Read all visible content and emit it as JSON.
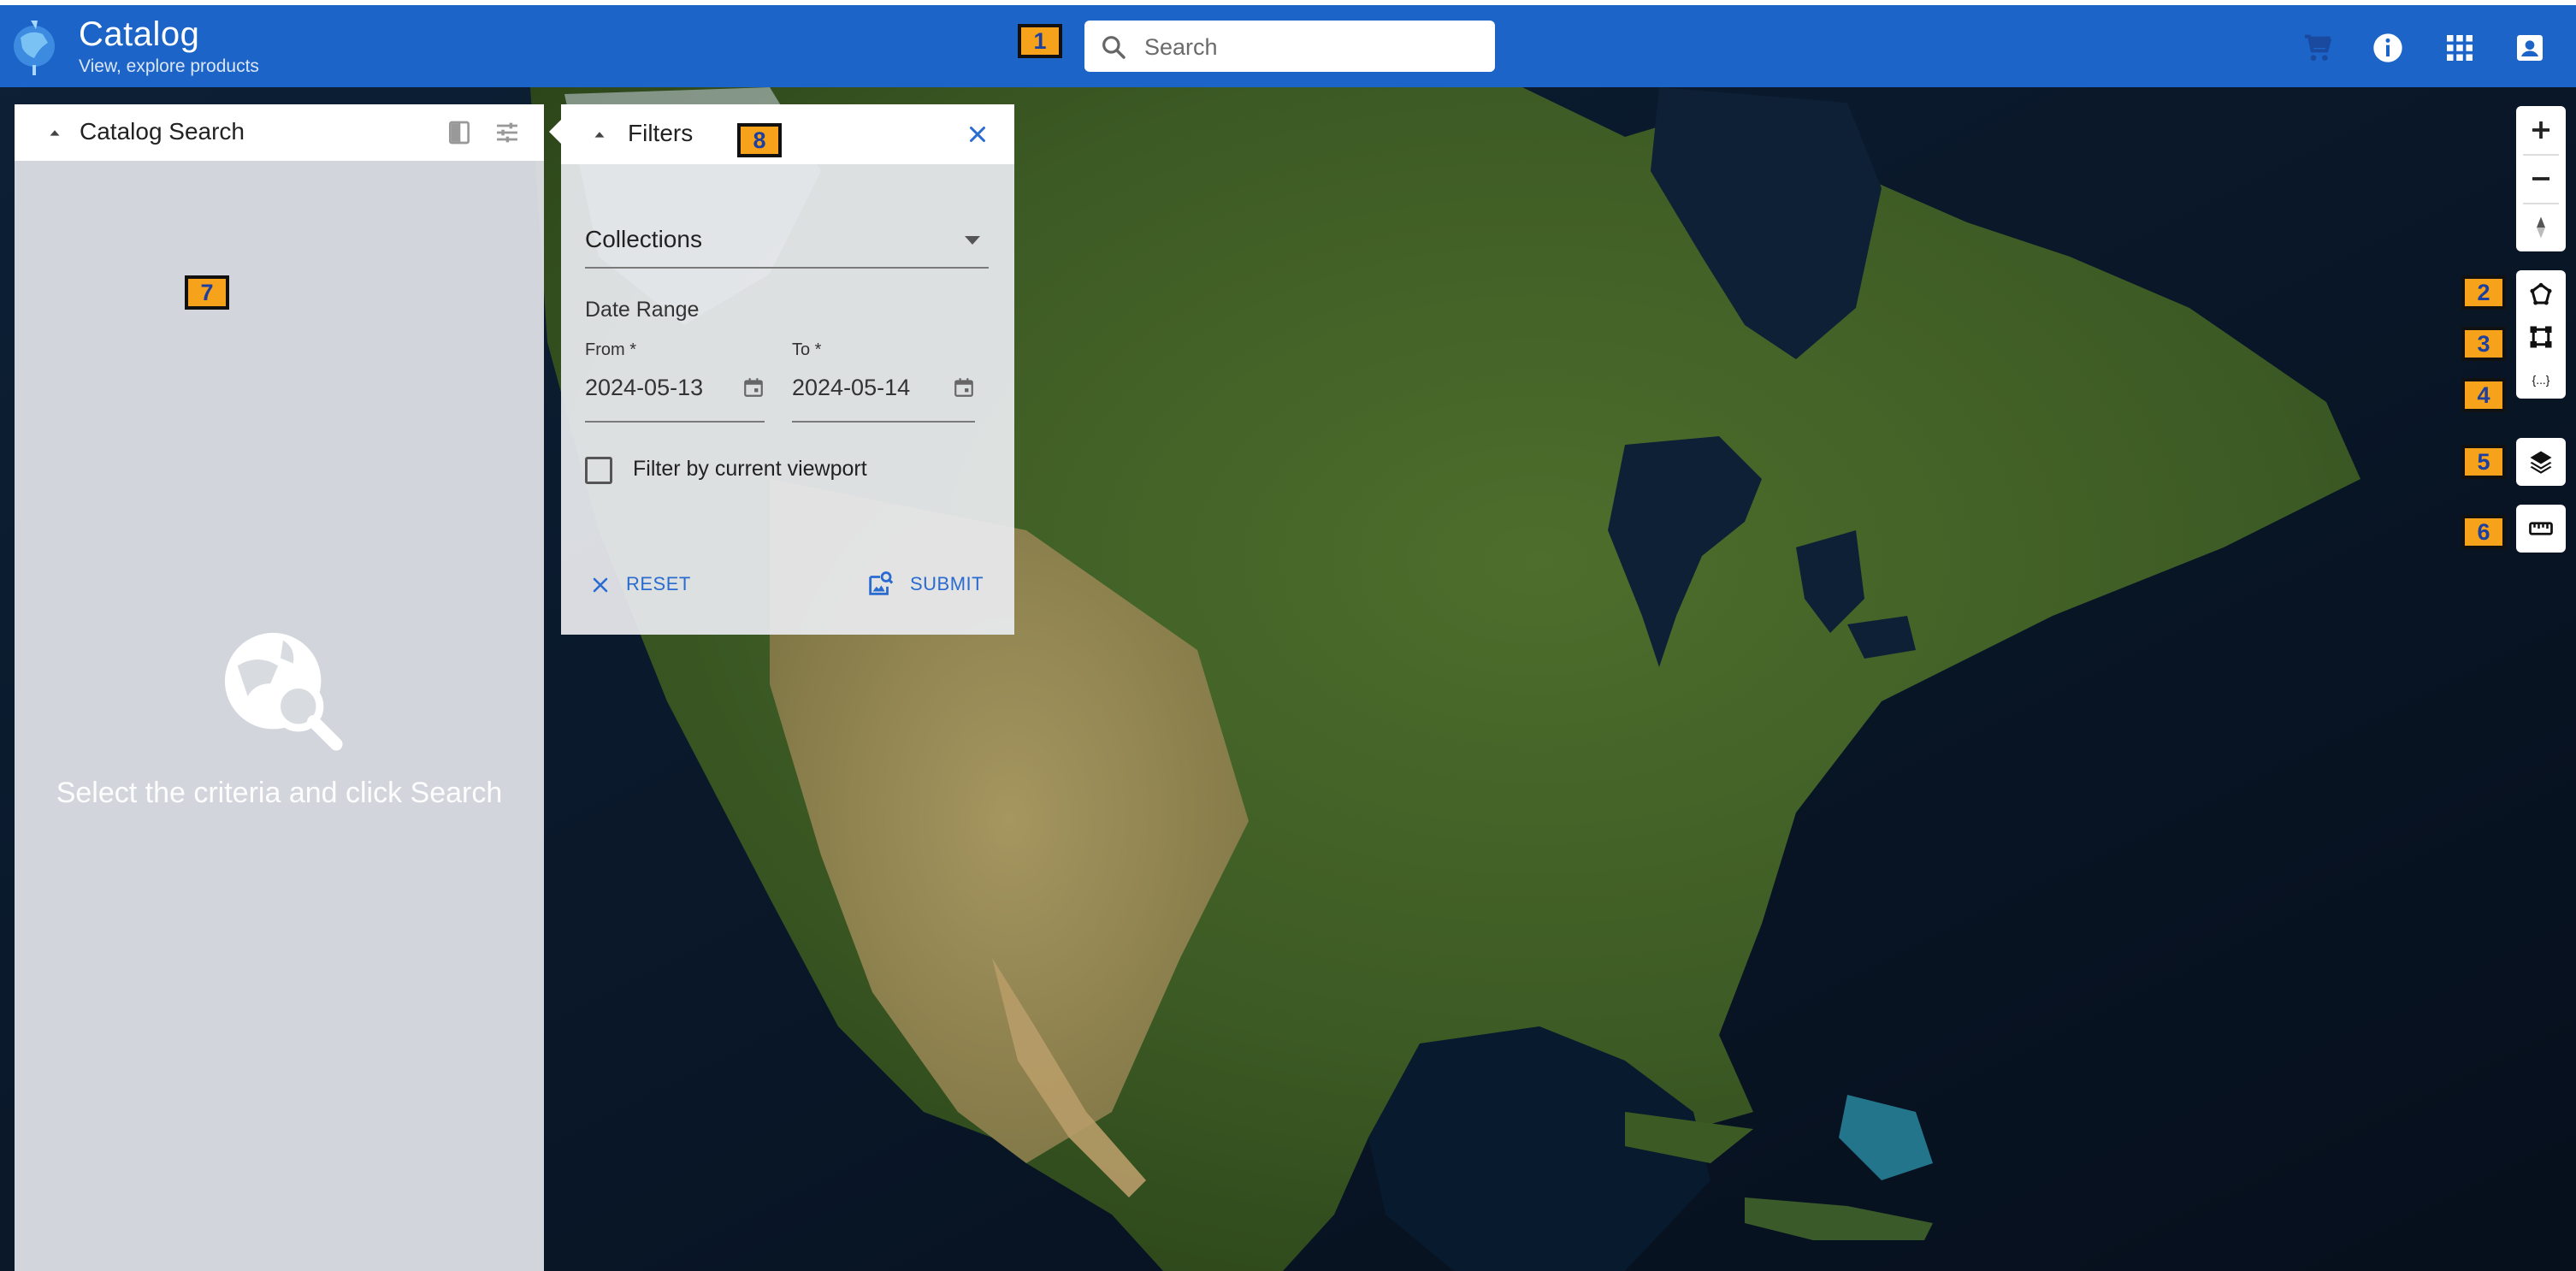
{
  "header": {
    "title": "Catalog",
    "subtitle": "View, explore products",
    "search_placeholder": "Search",
    "icons": [
      "cart-icon",
      "info-icon",
      "apps-icon",
      "account-icon"
    ],
    "color": "#1c64c8"
  },
  "catalog_panel": {
    "title": "Catalog Search",
    "empty_message": "Select the criteria and click Search"
  },
  "filters_panel": {
    "title": "Filters",
    "collections_label": "Collections",
    "date_range_label": "Date Range",
    "from_label": "From *",
    "from_value": "2024-05-13",
    "to_label": "To *",
    "to_value": "2024-05-14",
    "viewport_filter_label": "Filter by current viewport",
    "viewport_filter_checked": false,
    "reset_label": "RESET",
    "submit_label": "SUBMIT"
  },
  "map_tools": {
    "zoom": [
      "zoom-in-icon",
      "zoom-out-icon",
      "compass-icon"
    ],
    "tools": [
      "draw-polygon-icon",
      "draw-rectangle-icon",
      "geojson-icon",
      "layers-icon",
      "ruler-icon"
    ]
  },
  "badges": [
    "1",
    "2",
    "3",
    "4",
    "5",
    "6",
    "7",
    "8"
  ],
  "colors": {
    "accent": "#2a6bd0",
    "badge": "#f7a21b"
  }
}
